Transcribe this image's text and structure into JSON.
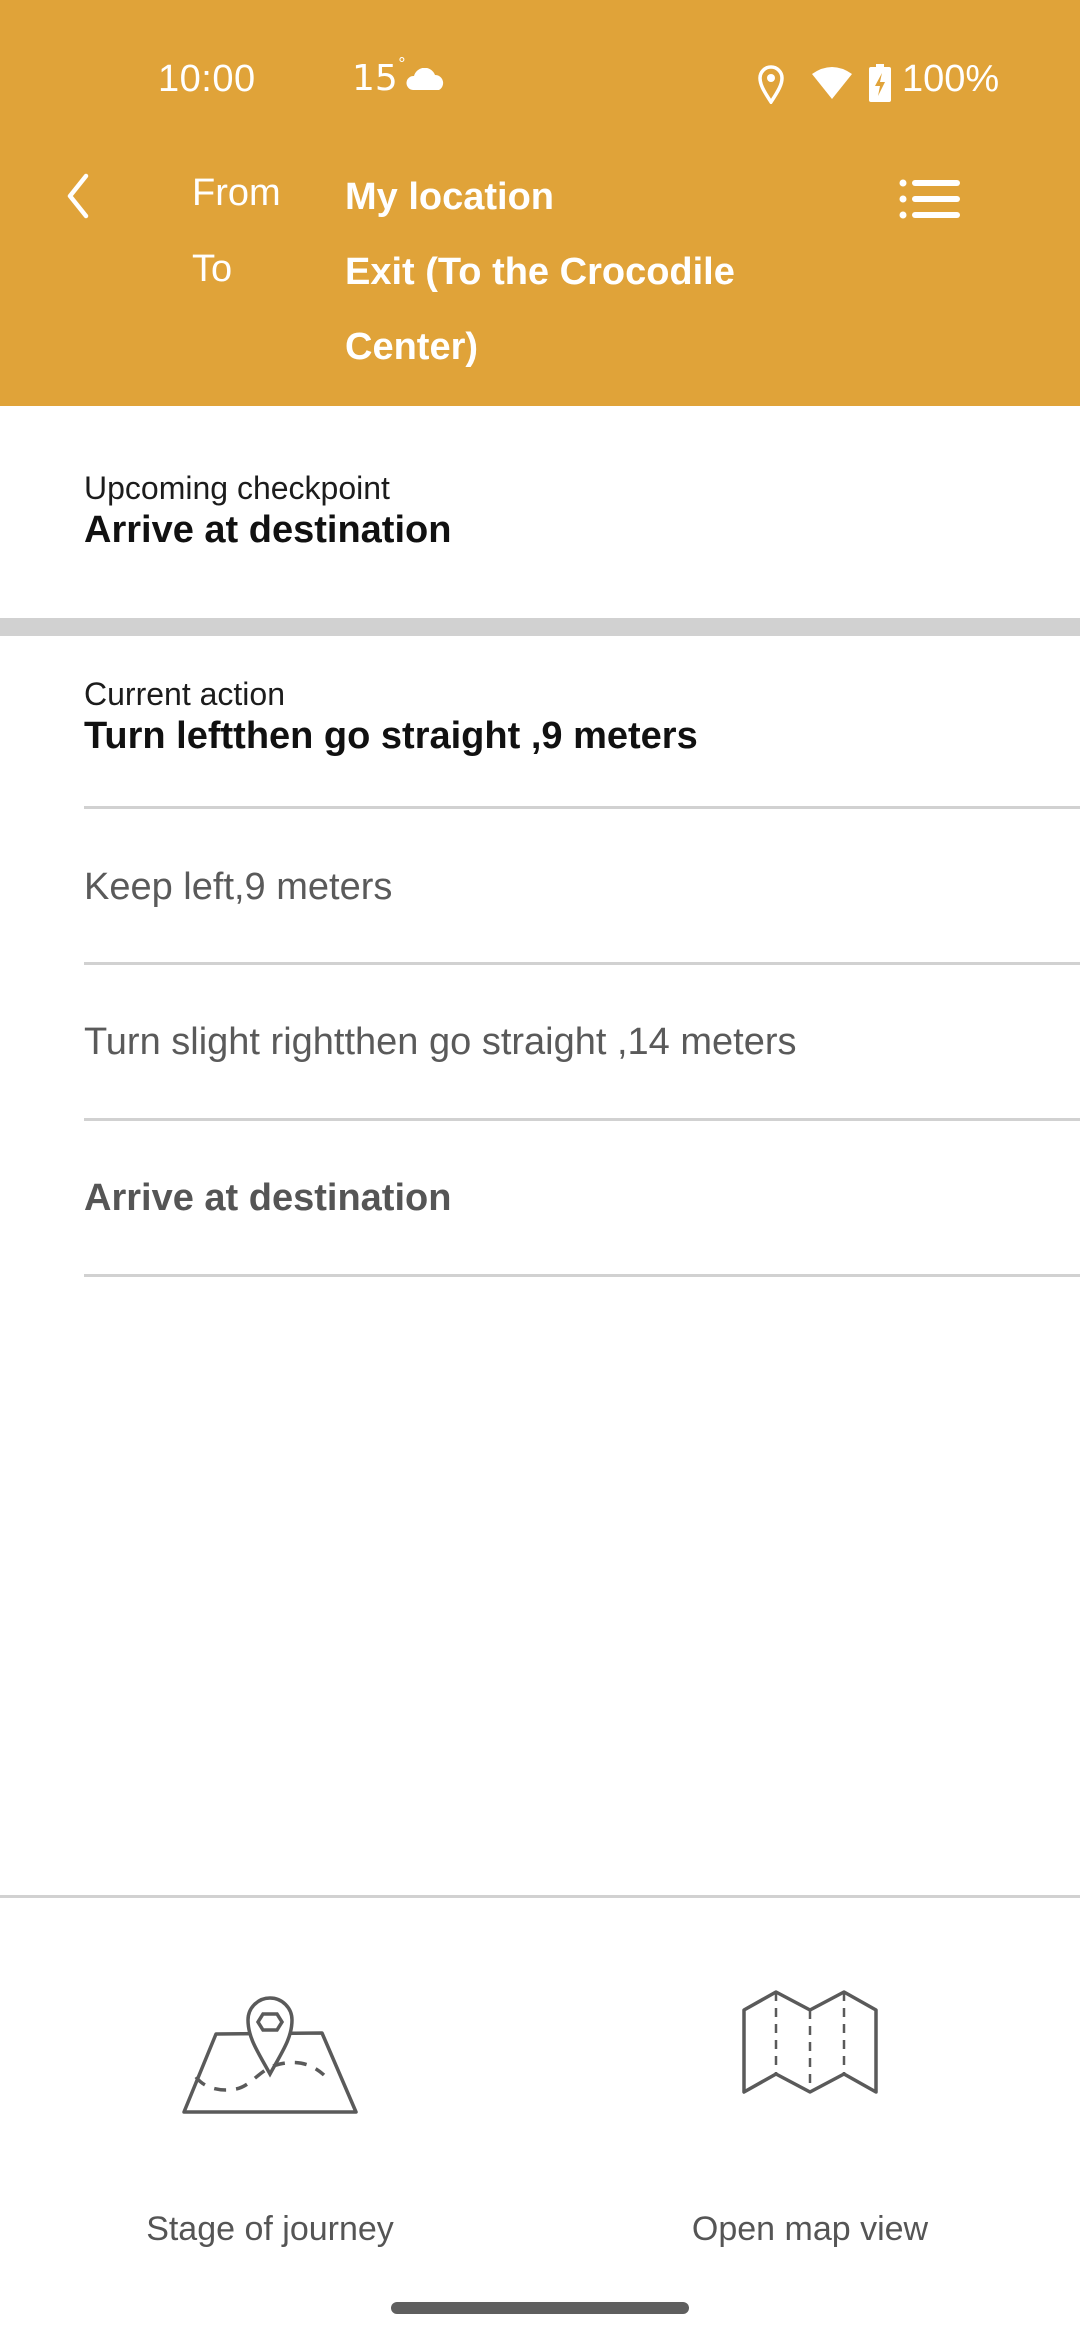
{
  "status_bar": {
    "time": "10:00",
    "temperature": "15",
    "temperature_unit": "°",
    "weather_icon": "cloud-icon",
    "icons": [
      "location-icon",
      "wifi-icon",
      "battery-charging-icon"
    ],
    "battery": "100%"
  },
  "header": {
    "background_color": "#E0A339",
    "back_icon": "chevron-left-icon",
    "from_label": "From",
    "from_value": "My location",
    "to_label": "To",
    "to_value": "Exit (To the Crocodile Center)",
    "menu_icon": "list-icon"
  },
  "checkpoint": {
    "label": "Upcoming checkpoint",
    "value": "Arrive at destination"
  },
  "current_action": {
    "label": "Current action",
    "value": "Turn leftthen go straight ,9 meters"
  },
  "steps": [
    {
      "text": "Keep left,9 meters",
      "bold": false
    },
    {
      "text": "Turn slight rightthen go straight ,14 meters",
      "bold": false
    },
    {
      "text": "Arrive at destination",
      "bold": true
    }
  ],
  "bottom_actions": [
    {
      "label": "Stage of journey",
      "icon": "map-pin-route-icon"
    },
    {
      "label": "Open map view",
      "icon": "folded-map-icon"
    }
  ]
}
